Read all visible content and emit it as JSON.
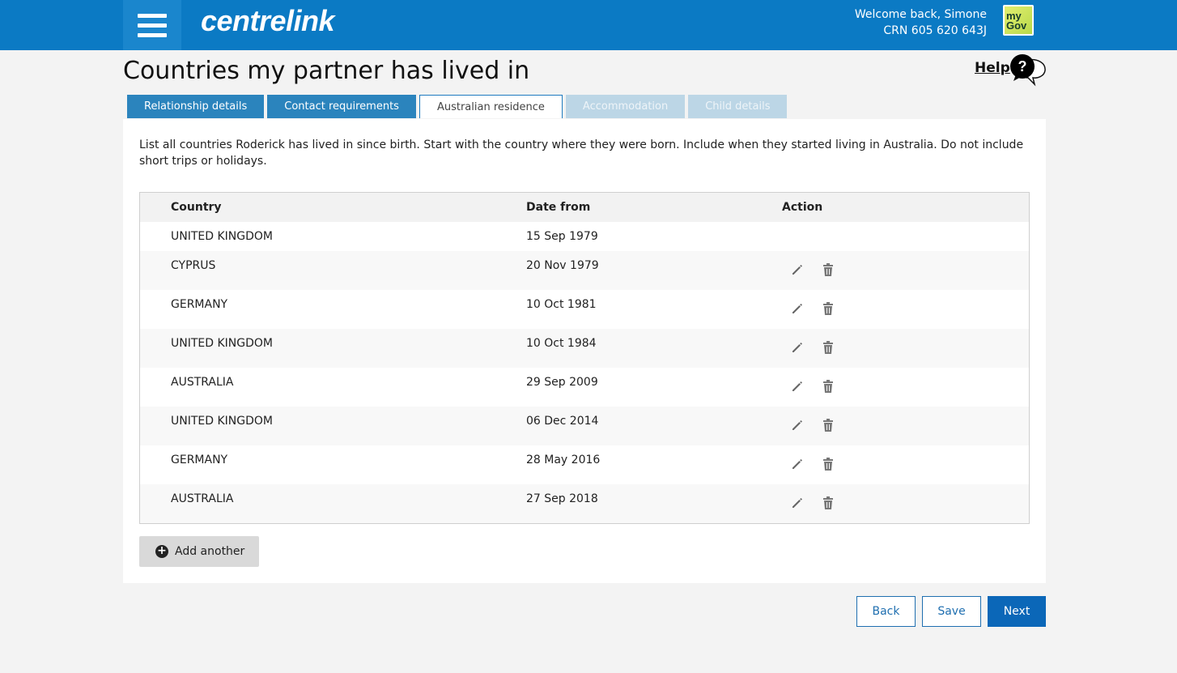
{
  "header": {
    "logo": "centrelink",
    "welcome": "Welcome back, Simone",
    "crn": "CRN 605 620 643J",
    "mygov_line1": "my",
    "mygov_line2": "Gov"
  },
  "page": {
    "title": "Countries my partner has lived in",
    "help_label": "Help",
    "help_icon_glyph": "?"
  },
  "tabs": [
    {
      "label": "Relationship details",
      "state": "done"
    },
    {
      "label": "Contact requirements",
      "state": "done"
    },
    {
      "label": "Australian residence",
      "state": "active"
    },
    {
      "label": "Accommodation",
      "state": "disabled"
    },
    {
      "label": "Child details",
      "state": "disabled"
    }
  ],
  "instructions": "List all countries Roderick has lived in since birth. Start with the country where they were born. Include when they started living in Australia. Do not include short trips or holidays.",
  "table": {
    "headers": {
      "country": "Country",
      "date_from": "Date from",
      "action": "Action"
    },
    "rows": [
      {
        "country": "UNITED KINGDOM",
        "date_from": "15 Sep 1979",
        "actions": false
      },
      {
        "country": "CYPRUS",
        "date_from": "20 Nov 1979",
        "actions": true
      },
      {
        "country": "GERMANY",
        "date_from": "10 Oct 1981",
        "actions": true
      },
      {
        "country": "UNITED KINGDOM",
        "date_from": "10 Oct 1984",
        "actions": true
      },
      {
        "country": "AUSTRALIA",
        "date_from": "29 Sep 2009",
        "actions": true
      },
      {
        "country": "UNITED KINGDOM",
        "date_from": "06 Dec 2014",
        "actions": true
      },
      {
        "country": "GERMANY",
        "date_from": "28 May 2016",
        "actions": true
      },
      {
        "country": "AUSTRALIA",
        "date_from": "27 Sep 2018",
        "actions": true
      }
    ]
  },
  "add_button": "Add another",
  "footer": {
    "back": "Back",
    "save": "Save",
    "next": "Next"
  },
  "colors": {
    "header_bg": "#0b7ac4",
    "tab_done": "#2b84bd",
    "tab_disabled": "#bcd6e6",
    "primary_button": "#0b67b8"
  }
}
